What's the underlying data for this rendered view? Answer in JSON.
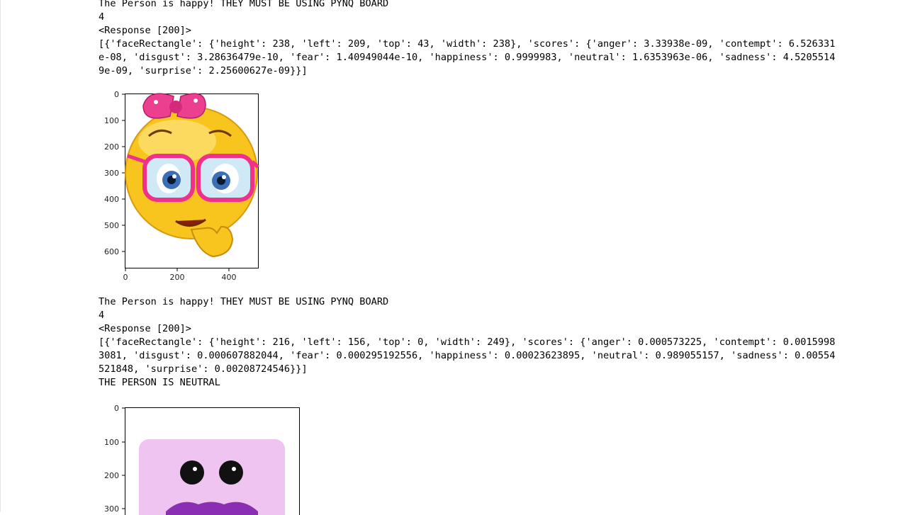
{
  "output_block_1": {
    "lines": [
      "The Person is happy! THEY MUST BE USING PYNQ BOARD",
      "4",
      "<Response [200]>",
      "[{'faceRectangle': {'height': 238, 'left': 209, 'top': 43, 'width': 238}, 'scores': {'anger': 3.33938e-09, 'contempt': 6.526331",
      "e-08, 'disgust': 3.28636479e-10, 'fear': 1.40949044e-10, 'happiness': 0.9999983, 'neutral': 1.6353963e-06, 'sadness': 4.5205514",
      "9e-09, 'surprise': 2.25600627e-09}}]"
    ]
  },
  "plot_1": {
    "image_subject": "girl-emoji-with-pink-bow-and-glasses",
    "y_ticks": [
      "0",
      "100",
      "200",
      "300",
      "400",
      "500",
      "600"
    ],
    "x_ticks": [
      "0",
      "200",
      "400"
    ]
  },
  "output_block_2": {
    "lines": [
      "The Person is happy! THEY MUST BE USING PYNQ BOARD",
      "4",
      "<Response [200]>",
      "[{'faceRectangle': {'height': 216, 'left': 156, 'top': 0, 'width': 249}, 'scores': {'anger': 0.000573225, 'contempt': 0.0015998",
      "3081, 'disgust': 0.000607882044, 'fear': 0.000295192556, 'happiness': 0.00023623895, 'neutral': 0.989055157, 'sadness': 0.00554",
      "521848, 'surprise': 0.00208724546}}]",
      "THE PERSON IS NEUTRAL"
    ]
  },
  "plot_2": {
    "image_subject": "pink-square-face-with-mustache",
    "y_ticks": [
      "0",
      "100",
      "200",
      "300"
    ]
  },
  "colors": {
    "emoji_yellow": "#f7c51e",
    "bow_pink": "#ec3f8f",
    "glasses_pink": "#f0308a",
    "square_pink": "#f0c4f0",
    "mustache_purple": "#8a2fb3"
  }
}
